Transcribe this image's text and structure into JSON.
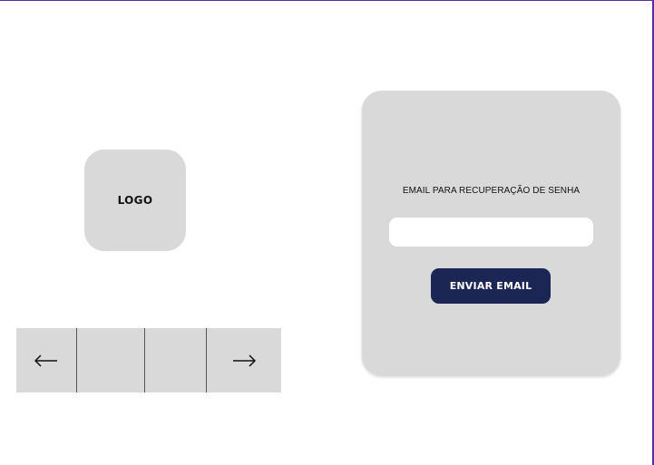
{
  "logo": {
    "label": "LOGO"
  },
  "carousel": {
    "prev_icon": "arrow-left-icon",
    "next_icon": "arrow-right-icon"
  },
  "recovery_card": {
    "label": "EMAIL PARA RECUPERAÇÃO DE SENHA",
    "email_value": "",
    "email_placeholder": "",
    "send_button_label": "ENVIAR EMAIL"
  },
  "colors": {
    "frame_border": "#5b2aa6",
    "placeholder_gray": "#d9d9d9",
    "button_navy": "#1b2655",
    "input_background": "#ffffff"
  }
}
